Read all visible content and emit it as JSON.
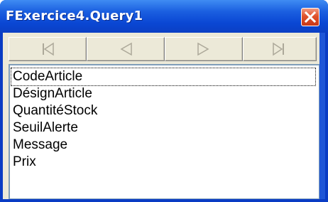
{
  "window": {
    "title": "FExercice4.Query1"
  },
  "titlebar": {
    "close_icon": "close-icon"
  },
  "navigator": {
    "buttons": [
      {
        "name": "first-record",
        "icon": "first-record-icon"
      },
      {
        "name": "prior-record",
        "icon": "prior-record-icon"
      },
      {
        "name": "next-record",
        "icon": "next-record-icon"
      },
      {
        "name": "last-record",
        "icon": "last-record-icon"
      }
    ]
  },
  "fields_list": {
    "items": [
      "CodeArticle",
      "DésignArticle",
      "QuantitéStock",
      "SeuilAlerte",
      "Message",
      "Prix"
    ],
    "focused_index": 0
  }
}
